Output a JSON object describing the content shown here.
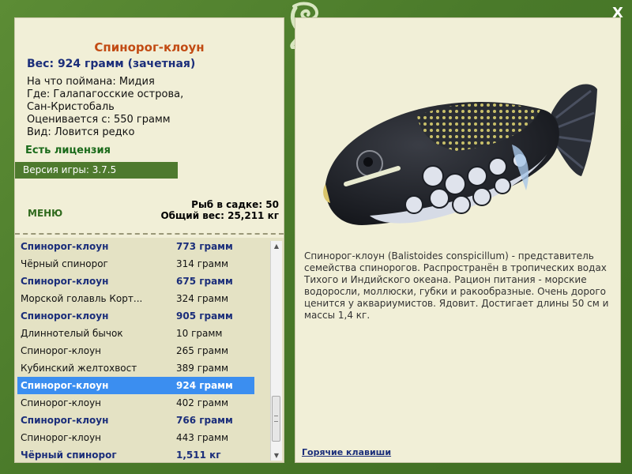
{
  "app": {
    "close_label": "X"
  },
  "fish": {
    "title": "Спинорог-клоун",
    "weight": "Вес: 924 грамм (зачетная)",
    "caught_on": "На что поймана: Мидия",
    "where_1": "Где: Галапагосские острова,",
    "where_2": "Сан-Кристобаль",
    "value": "Оценивается с: 550 грамм",
    "rarity": "Вид: Ловится редко"
  },
  "license": "Есть лицензия",
  "version": "Версия игры: 3.7.5",
  "menu_label": "МЕНЮ",
  "stats": {
    "count": "Рыб в садке: 50",
    "total": "Общий вес: 25,211 кг"
  },
  "catch_list": [
    {
      "name": "Спинорог-клоун",
      "weight": "773 грамм",
      "licensed": true
    },
    {
      "name": "Чёрный спинорог",
      "weight": "314 грамм",
      "licensed": false
    },
    {
      "name": "Спинорог-клоун",
      "weight": "675 грамм",
      "licensed": true
    },
    {
      "name": "Морской голавль Корт...",
      "weight": "324 грамм",
      "licensed": false
    },
    {
      "name": "Спинорог-клоун",
      "weight": "905 грамм",
      "licensed": true
    },
    {
      "name": "Длиннотелый бычок",
      "weight": "10 грамм",
      "licensed": false
    },
    {
      "name": "Спинорог-клоун",
      "weight": "265 грамм",
      "licensed": false
    },
    {
      "name": "Кубинский желтохвост",
      "weight": "389 грамм",
      "licensed": false
    },
    {
      "name": "Спинорог-клоун",
      "weight": "924 грамм",
      "licensed": true,
      "selected": true
    },
    {
      "name": "Спинорог-клоун",
      "weight": "402 грамм",
      "licensed": false
    },
    {
      "name": "Спинорог-клоун",
      "weight": "766 грамм",
      "licensed": true
    },
    {
      "name": "Спинорог-клоун",
      "weight": "443 грамм",
      "licensed": false
    },
    {
      "name": "Чёрный спинорог",
      "weight": "1,511 кг",
      "licensed": true
    }
  ],
  "description": "Спинорог-клоун (Balistoides conspicillum) - представитель семейства спинорогов. Распространён в тропических водах Тихого и Индийского океана. Рацион питания - морские водоросли, моллюски, губки и ракообразные. Очень дорого ценится у аквариумистов. Ядовит. Достигает длины 50 см и массы 1,4 кг.",
  "hotkeys_label": "Горячие клавиши",
  "colors": {
    "selected_row": "#3b8ef0",
    "licensed_text": "#1b2e7a",
    "title_text": "#c24b13",
    "frame": "#4d7a2b"
  }
}
